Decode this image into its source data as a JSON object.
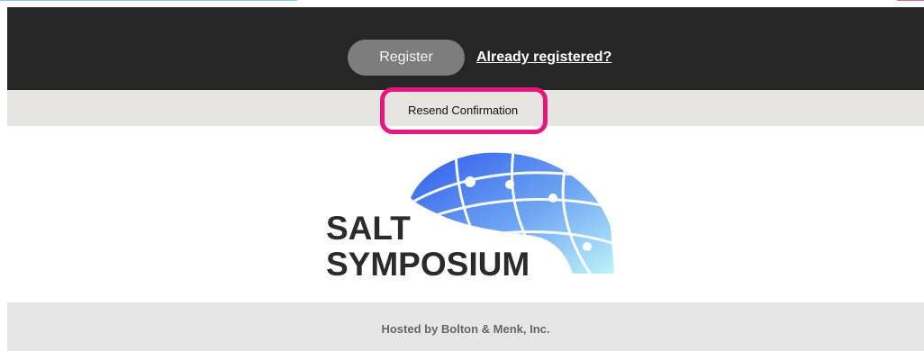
{
  "header": {
    "register_label": "Register",
    "already_registered_label": "Already registered?"
  },
  "resend": {
    "label": "Resend Confirmation"
  },
  "logo": {
    "line1": "SALT",
    "line2": "SYMPOSIUM",
    "gradient_start": "#2f5bea",
    "gradient_end": "#bdf3f8"
  },
  "footer": {
    "hosted_text": "Hosted by Bolton & Menk, Inc."
  },
  "colors": {
    "header_bg": "#262626",
    "button_bg": "#7d7d7d",
    "resend_bar_bg": "#e6e4e1",
    "highlight": "#e5167d",
    "footer_bg": "#e6e6e6"
  }
}
